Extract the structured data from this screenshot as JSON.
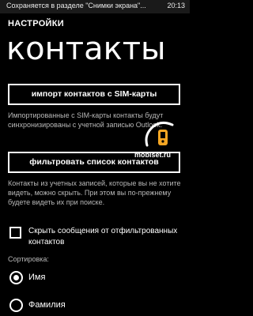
{
  "status_bar": {
    "message": "Сохраняется в разделе \"Снимки экрана\"...",
    "time": "20:13"
  },
  "header": {
    "app_title": "НАСТРОЙКИ",
    "page_title": "контакты"
  },
  "import_section": {
    "button_label": "импорт контактов с SIM-карты",
    "description": "Импортированные с SIM-карты контакты будут синхронизированы с учетной записью Outlook."
  },
  "filter_section": {
    "button_label": "фильтровать список контактов",
    "description": "Контакты из учетных записей, которые вы не хотите видеть, можно скрыть. При этом вы по-прежнему будете видеть их при поиске."
  },
  "hide_messages": {
    "label": "Скрыть сообщения от отфильтрованных контактов",
    "checked": false
  },
  "sort": {
    "label": "Сортировка:",
    "options": [
      {
        "label": "Имя",
        "selected": true
      },
      {
        "label": "Фамилия",
        "selected": false
      }
    ]
  },
  "watermark": {
    "text": "mobiset.ru"
  },
  "colors": {
    "background": "#000000",
    "foreground": "#ffffff",
    "secondary_text": "#b8b8b8",
    "watermark_accent": "#f5a623"
  }
}
